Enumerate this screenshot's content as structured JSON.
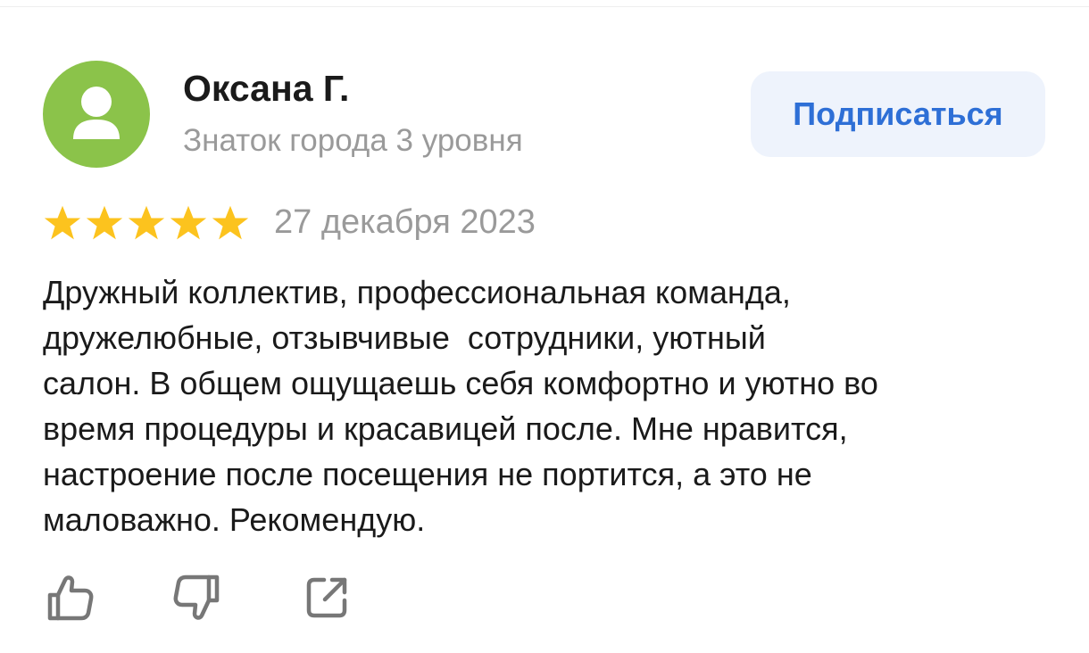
{
  "author": {
    "name": "Оксана Г.",
    "level": "Знаток города 3 уровня",
    "avatar_icon": "user-icon",
    "avatar_color": "#8bc34a"
  },
  "subscribe": {
    "label": "Подписаться",
    "color": "#2e6fd6",
    "background": "#eef3fc"
  },
  "review": {
    "rating": 5,
    "rating_max": 5,
    "star_color": "#fcc31e",
    "date": "27 декабря 2023",
    "text": "Дружный коллектив, профессиональная команда,\nдружелюбные, отзывчивые  сотрудники, уютный\nсалон. В общем ощущаешь себя комфортно и уютно во\nвремя процедуры и красавицей после. Мне нравится,\nнастроение после посещения не портится, а это не\nмаловажно. Рекомендую."
  },
  "actions": [
    {
      "icon": "thumbs-up-icon"
    },
    {
      "icon": "thumbs-down-icon"
    },
    {
      "icon": "share-icon"
    }
  ]
}
